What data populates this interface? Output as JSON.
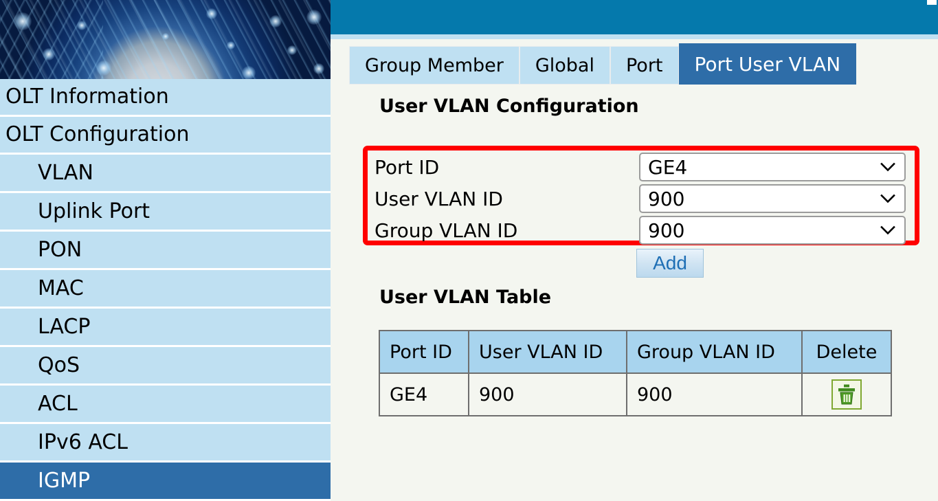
{
  "banner": {
    "alt": "globe-network-banner"
  },
  "sidebar": {
    "items": [
      {
        "label": "OLT Information",
        "level": 1,
        "selected": false
      },
      {
        "label": "OLT Configuration",
        "level": 1,
        "selected": false
      },
      {
        "label": "VLAN",
        "level": 2,
        "selected": false
      },
      {
        "label": "Uplink Port",
        "level": 2,
        "selected": false
      },
      {
        "label": "PON",
        "level": 2,
        "selected": false
      },
      {
        "label": "MAC",
        "level": 2,
        "selected": false
      },
      {
        "label": "LACP",
        "level": 2,
        "selected": false
      },
      {
        "label": "QoS",
        "level": 2,
        "selected": false
      },
      {
        "label": "ACL",
        "level": 2,
        "selected": false
      },
      {
        "label": "IPv6 ACL",
        "level": 2,
        "selected": false
      },
      {
        "label": "IGMP",
        "level": 2,
        "selected": true
      }
    ]
  },
  "tabs": [
    {
      "label": "Group Member",
      "active": false
    },
    {
      "label": "Global",
      "active": false
    },
    {
      "label": "Port",
      "active": false
    },
    {
      "label": "Port User VLAN",
      "active": true
    }
  ],
  "config": {
    "heading": "User VLAN Configuration",
    "fields": [
      {
        "label": "Port ID",
        "value": "GE4"
      },
      {
        "label": "User VLAN ID",
        "value": "900"
      },
      {
        "label": "Group VLAN ID",
        "value": "900"
      }
    ],
    "add_label": "Add"
  },
  "table": {
    "heading": "User VLAN Table",
    "columns": [
      "Port ID",
      "User VLAN ID",
      "Group VLAN ID",
      "Delete"
    ],
    "rows": [
      {
        "port_id": "GE4",
        "user_vlan_id": "900",
        "group_vlan_id": "900",
        "delete_icon": "trash-icon"
      }
    ]
  },
  "colors": {
    "header_blue": "#0579ac",
    "nav_light_blue": "#bfe0f2",
    "selected_blue": "#2e6da8",
    "highlight_red": "#ff0000",
    "table_header_blue": "#a8d4ee",
    "content_bg": "#f4f6f0",
    "trash_green": "#3f8a1e",
    "cursor_green": "#b4e830"
  }
}
